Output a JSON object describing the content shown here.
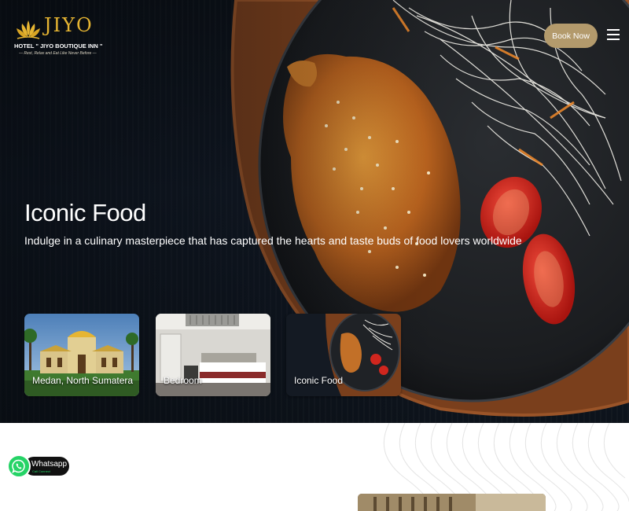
{
  "header": {
    "logo_word": "JIYO",
    "logo_name": "HOTEL \" JIYO BOUTIQUE INN \"",
    "logo_tagline": "— Rest, Relax and Eat Like Never Before —",
    "book_label": "Book Now",
    "menu_icon": "hamburger-menu-icon"
  },
  "hero": {
    "title": "Iconic Food",
    "subtitle": "Indulge in a culinary masterpiece that has captured the hearts and taste buds of food lovers worldwide"
  },
  "cards": [
    {
      "label": "Medan, North Sumatera"
    },
    {
      "label": "Bedroom"
    },
    {
      "label": "Iconic Food"
    }
  ],
  "whatsapp": {
    "title": "Whatsapp",
    "subtitle": "Call Connect",
    "icon": "whatsapp-icon"
  },
  "colors": {
    "brand_gold": "#e6b532",
    "book_button": "#b39a6c",
    "whatsapp_green": "#25d366"
  }
}
